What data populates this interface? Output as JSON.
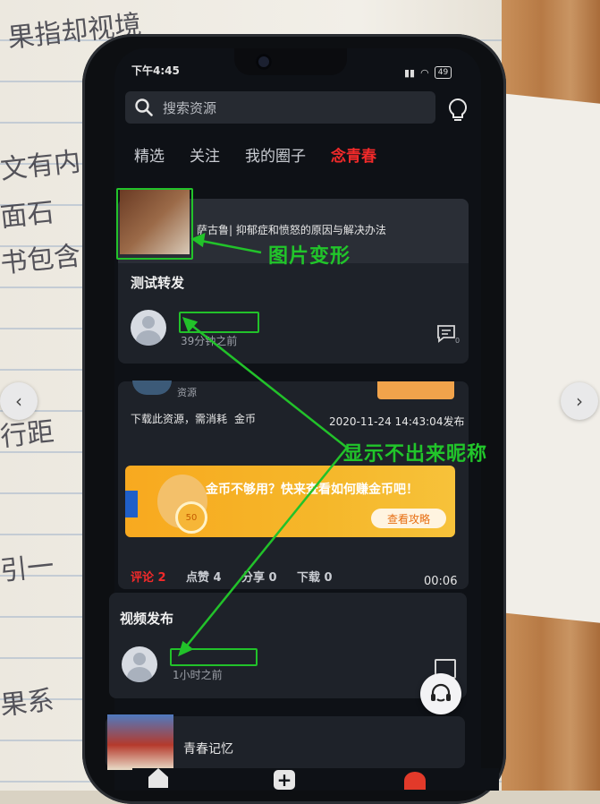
{
  "status": {
    "time": "下午4:45",
    "battery": "49"
  },
  "search": {
    "placeholder": "搜索资源"
  },
  "tabs": [
    "精选",
    "关注",
    "我的圈子",
    "念青春"
  ],
  "post1": {
    "link_title": "萨古鲁| 抑郁症和愤怒的原因与解决办法",
    "title": "测试转发",
    "time": "39分钟之前",
    "comment_count": "0"
  },
  "post2": {
    "source": "资源",
    "download_text": "下载此资源，需消耗",
    "coin_label": "金币",
    "published": "2020-11-24 14:43:04发布",
    "banner_text": "金币不够用？快来查看如何赚金币吧！",
    "banner_btn": "查看攻略",
    "coin_badge": "50",
    "stats": {
      "comment_label": "评论",
      "comment_count": "2",
      "like_label": "点赞",
      "like_count": "4",
      "share_label": "分享",
      "share_count": "0",
      "download_label": "下载",
      "download_count": "0"
    },
    "duration": "00:06"
  },
  "post3": {
    "title": "视频发布",
    "time": "1小时之前"
  },
  "post4": {
    "title": "青春记忆"
  },
  "annotations": {
    "image_deformed": "图片变形",
    "nickname_missing": "显示不出来昵称"
  },
  "colors": {
    "accent": "#f22a2a",
    "annotation": "#21c52a",
    "banner": "#f8a91f"
  }
}
